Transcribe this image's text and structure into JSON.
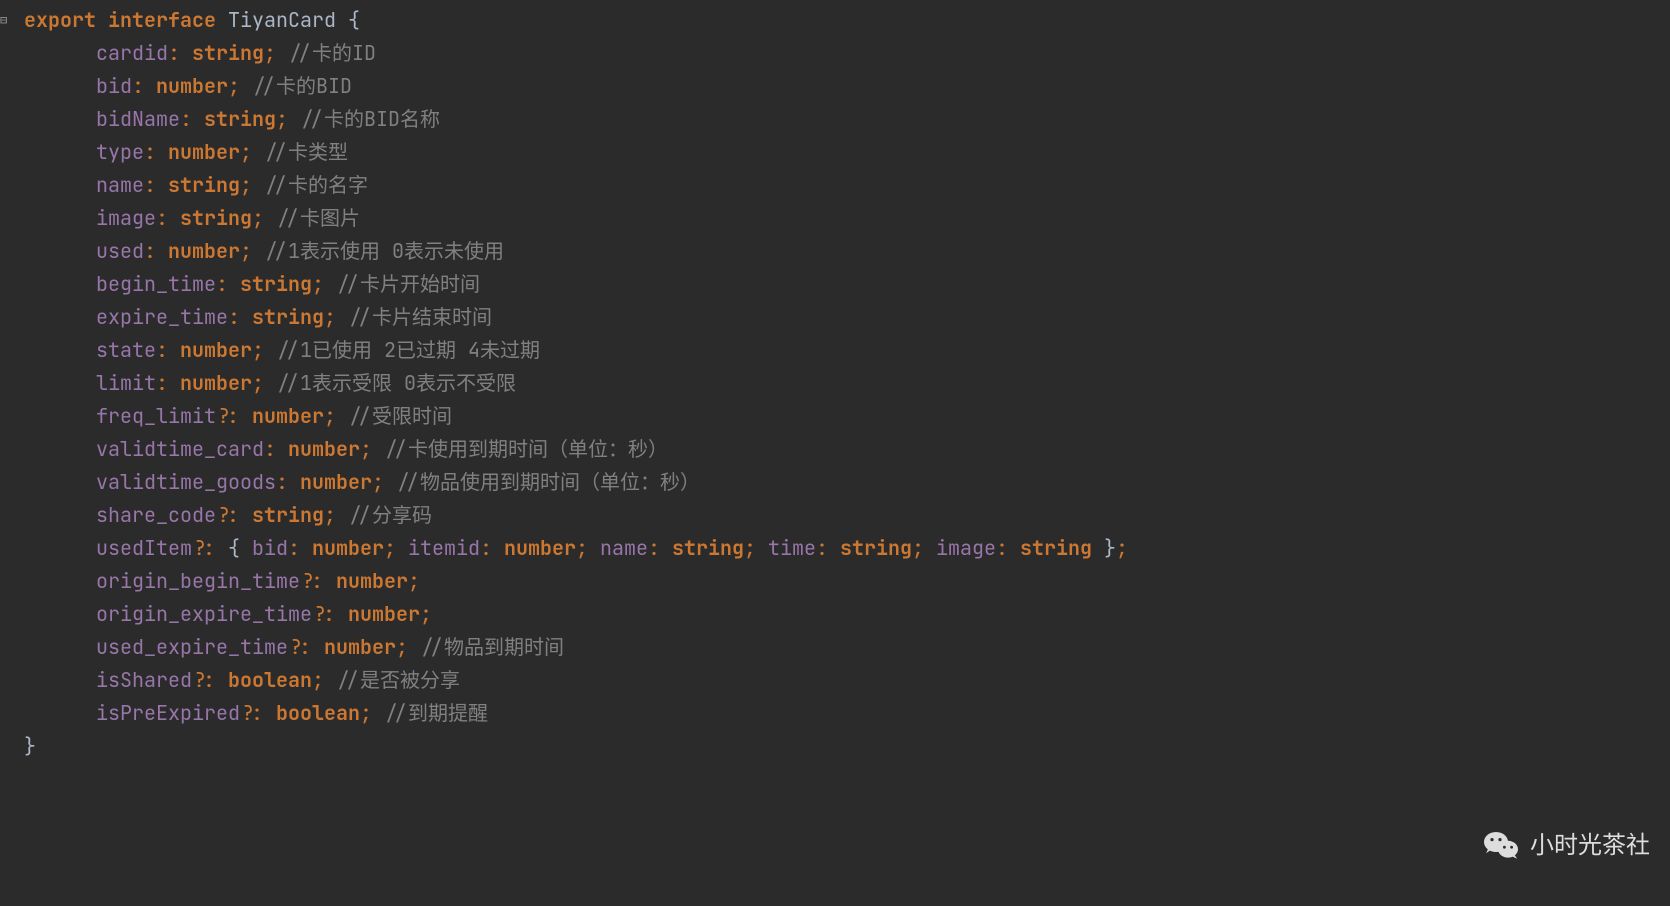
{
  "watermark": "小时光茶社",
  "fold_top": "⊟",
  "fold_bottom": "⊟",
  "code": {
    "keywords": {
      "export": "export",
      "interface": "interface"
    },
    "interface_name": "TiyanCard",
    "types": {
      "string": "string",
      "number": "number",
      "boolean": "boolean"
    },
    "lines": [
      {
        "prop": "cardid",
        "type": "string",
        "comment": "//卡的ID"
      },
      {
        "prop": "bid",
        "type": "number",
        "comment": "//卡的BID"
      },
      {
        "prop": "bidName",
        "type": "string",
        "comment": "//卡的BID名称"
      },
      {
        "prop": "type",
        "type": "number",
        "comment": "//卡类型"
      },
      {
        "prop": "name",
        "type": "string",
        "comment": "//卡的名字"
      },
      {
        "prop": "image",
        "type": "string",
        "comment": "//卡图片"
      },
      {
        "prop": "used",
        "type": "number",
        "comment": "//1表示使用 0表示未使用"
      },
      {
        "prop": "begin_time",
        "type": "string",
        "comment": "//卡片开始时间"
      },
      {
        "prop": "expire_time",
        "type": "string",
        "comment": "//卡片结束时间"
      },
      {
        "prop": "state",
        "type": "number",
        "comment": "//1已使用 2已过期 4未过期"
      },
      {
        "prop": "limit",
        "type": "number",
        "comment": "//1表示受限 0表示不受限"
      },
      {
        "prop": "freq_limit",
        "optional": true,
        "type": "number",
        "comment": "//受限时间"
      },
      {
        "prop": "validtime_card",
        "type": "number",
        "comment": "//卡使用到期时间（单位：秒）"
      },
      {
        "prop": "validtime_goods",
        "type": "number",
        "comment": "//物品使用到期时间（单位：秒）"
      },
      {
        "prop": "share_code",
        "optional": true,
        "type": "string",
        "comment": "//分享码"
      }
    ],
    "useditem": {
      "prop": "usedItem",
      "props": [
        {
          "name": "bid",
          "type": "number"
        },
        {
          "name": "itemid",
          "type": "number"
        },
        {
          "name": "name",
          "type": "string"
        },
        {
          "name": "time",
          "type": "string"
        },
        {
          "name": "image",
          "type": "string"
        }
      ]
    },
    "trailing": [
      {
        "prop": "origin_begin_time",
        "optional": true,
        "type": "number",
        "comment": ""
      },
      {
        "prop": "origin_expire_time",
        "optional": true,
        "type": "number",
        "comment": ""
      },
      {
        "prop": "used_expire_time",
        "optional": true,
        "type": "number",
        "comment": "//物品到期时间"
      },
      {
        "prop": "isShared",
        "optional": true,
        "type": "boolean",
        "comment": "//是否被分享"
      },
      {
        "prop": "isPreExpired",
        "optional": true,
        "type": "boolean",
        "comment": "//到期提醒"
      }
    ]
  }
}
